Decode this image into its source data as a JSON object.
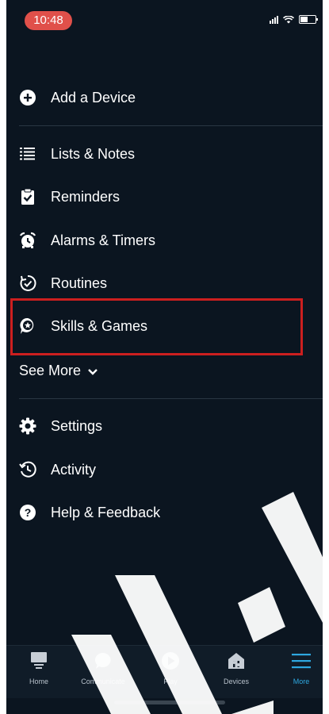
{
  "status_bar": {
    "time": "10:48"
  },
  "menu": {
    "add_device": "Add a Device",
    "items": [
      {
        "label": "Lists & Notes",
        "icon": "list-icon"
      },
      {
        "label": "Reminders",
        "icon": "reminder-clipboard-icon"
      },
      {
        "label": "Alarms & Timers",
        "icon": "alarm-clock-icon"
      },
      {
        "label": "Routines",
        "icon": "routines-icon"
      },
      {
        "label": "Skills & Games",
        "icon": "skills-icon"
      }
    ],
    "see_more": "See More",
    "settings_items": [
      {
        "label": "Settings",
        "icon": "gear-icon"
      },
      {
        "label": "Activity",
        "icon": "history-icon"
      },
      {
        "label": "Help & Feedback",
        "icon": "help-icon"
      }
    ]
  },
  "tabs": [
    {
      "label": "Home",
      "icon": "home-icon"
    },
    {
      "label": "Communicate",
      "icon": "chat-bubble-icon"
    },
    {
      "label": "Play",
      "icon": "play-icon"
    },
    {
      "label": "Devices",
      "icon": "devices-icon"
    },
    {
      "label": "More",
      "icon": "menu-lines-icon",
      "active": true
    }
  ],
  "colors": {
    "background": "#0b1520",
    "accent": "#2ea8e0",
    "highlight": "#cc1f1f",
    "status_pill": "#e0504a"
  }
}
